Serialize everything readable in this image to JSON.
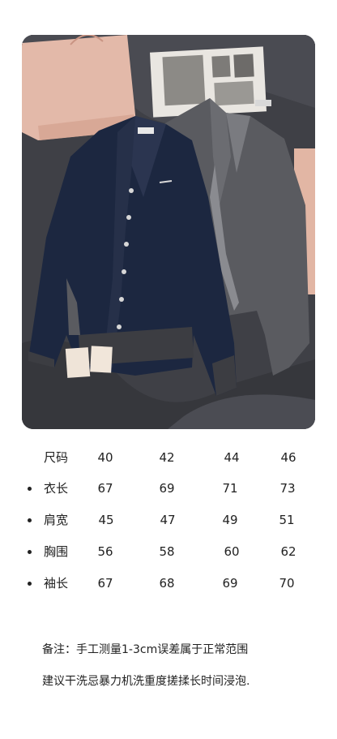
{
  "photo": {
    "alt_icon": "product-photo-cardigans"
  },
  "size_table": {
    "header": {
      "label": "尺码",
      "values": [
        "40",
        "42",
        "44",
        "46"
      ]
    },
    "rows": [
      {
        "label": "衣长",
        "values": [
          "67",
          "69",
          "71",
          "73"
        ]
      },
      {
        "label": "肩宽",
        "values": [
          "45",
          "47",
          "49",
          "51"
        ]
      },
      {
        "label": "胸围",
        "values": [
          "56",
          "58",
          "60",
          "62"
        ]
      },
      {
        "label": "袖长",
        "values": [
          "67",
          "68",
          "69",
          "70"
        ]
      }
    ]
  },
  "notes": {
    "line1": "备注：手工测量1-3cm误差属于正常范围",
    "line2": "建议干洗忌暴力机洗重度搓揉长时间浸泡."
  }
}
